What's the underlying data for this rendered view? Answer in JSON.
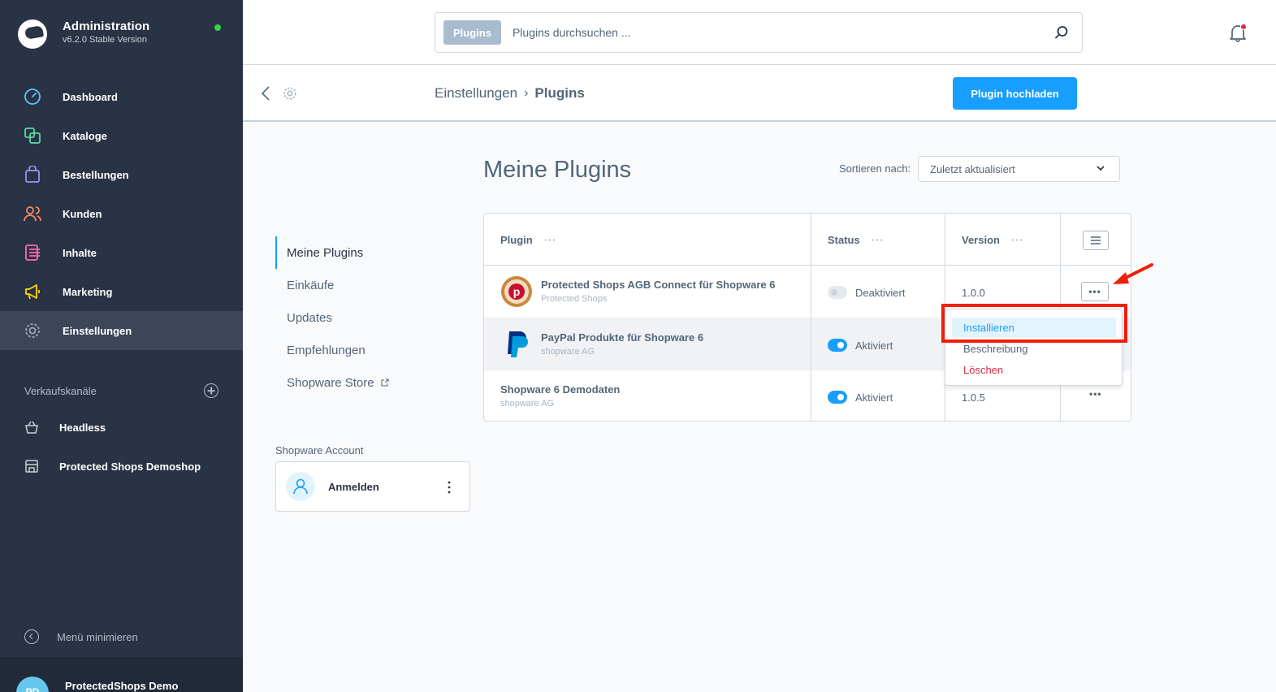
{
  "app": {
    "title": "Administration",
    "version": "v6.2.0 Stable Version"
  },
  "sidebar": {
    "items": [
      {
        "label": "Dashboard",
        "icon": "dashboard-icon",
        "color": "#57d9a3"
      },
      {
        "label": "Kataloge",
        "icon": "catalog-icon",
        "color": "#57d9a3"
      },
      {
        "label": "Bestellungen",
        "icon": "orders-icon",
        "color": "#a092f0"
      },
      {
        "label": "Kunden",
        "icon": "customers-icon",
        "color": "#f88962"
      },
      {
        "label": "Inhalte",
        "icon": "content-icon",
        "color": "#ff68b4"
      },
      {
        "label": "Marketing",
        "icon": "marketing-icon",
        "color": "#ffd700"
      },
      {
        "label": "Einstellungen",
        "icon": "settings-icon",
        "color": "#9aa8b5"
      }
    ],
    "saleschannels_label": "Verkaufskanäle",
    "saleschannels": [
      {
        "label": "Headless",
        "icon": "headless-icon"
      },
      {
        "label": "Protected Shops Demoshop",
        "icon": "storefront-icon"
      }
    ],
    "minimize_label": "Menü minimieren",
    "user_initials": "PD",
    "user_name": "ProtectedShops Demo"
  },
  "search": {
    "tag": "Plugins",
    "placeholder": "Plugins durchsuchen ..."
  },
  "smartbar": {
    "breadcrumb": [
      "Einstellungen",
      "Plugins"
    ],
    "upload_label": "Plugin hochladen"
  },
  "page": {
    "title": "Meine Plugins",
    "sort_label": "Sortieren nach:",
    "sort_value": "Zuletzt aktualisiert"
  },
  "sidenav": {
    "items": [
      "Meine Plugins",
      "Einkäufe",
      "Updates",
      "Empfehlungen",
      "Shopware Store"
    ]
  },
  "account": {
    "label": "Shopware Account",
    "login": "Anmelden"
  },
  "grid": {
    "columns": [
      "Plugin",
      "Status",
      "Version"
    ],
    "rows": [
      {
        "name": "Protected Shops AGB Connect für Shopware 6",
        "vendor": "Protected Shops",
        "status": "Deaktiviert",
        "active": false,
        "version": "1.0.0"
      },
      {
        "name": "PayPal Produkte für Shopware 6",
        "vendor": "shopware AG",
        "status": "Aktiviert",
        "active": true,
        "version": ""
      },
      {
        "name": "Shopware 6 Demodaten",
        "vendor": "shopware AG",
        "status": "Aktiviert",
        "active": true,
        "version": "1.0.5"
      }
    ],
    "more": "•••"
  },
  "context_menu": {
    "items": [
      "Installieren",
      "Beschreibung",
      "Löschen"
    ]
  },
  "colors": {
    "accent": "#189eff",
    "sidebar": "#2a3345",
    "danger": "#de294c",
    "annotation": "#f11e0a"
  }
}
